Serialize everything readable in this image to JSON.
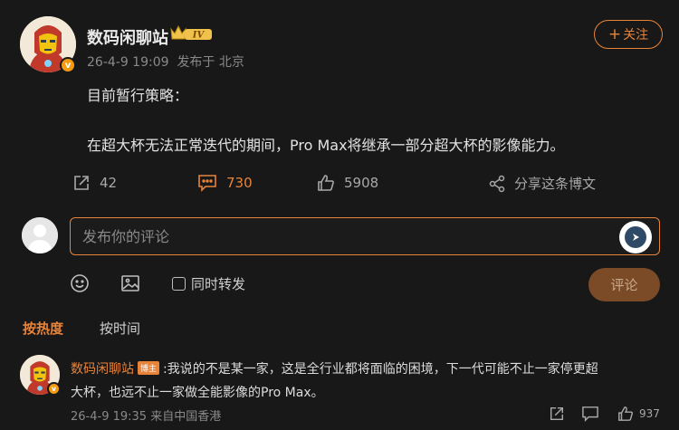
{
  "post": {
    "author": "数码闲聊站",
    "level_badge": "IV",
    "verified_mark": "v",
    "time": "26-4-9 19:09",
    "location": "发布于 北京",
    "follow_label": "关注",
    "text_line1": "目前暂行策略：",
    "text_line2": "在超大杯无法正常迭代的期间，Pro Max将继承一部分超大杯的影像能力。"
  },
  "actions": {
    "repost_count": "42",
    "comment_count": "730",
    "like_count": "5908",
    "share_label": "分享这条博文"
  },
  "composer": {
    "placeholder": "发布你的评论",
    "also_repost_label": "同时转发",
    "submit_label": "评论"
  },
  "sort_tabs": {
    "hot": "按热度",
    "time": "按时间"
  },
  "comment": {
    "author": "数码闲聊站",
    "host_badge": "博主",
    "text_line1": ":我说的不是某一家，这是全行业都将面临的困境，下一代可能不止一家停更超",
    "text_line2": "大杯，也远不止一家做全能影像的Pro Max。",
    "meta": "26-4-9 19:35 来自中国香港",
    "like_count": "937"
  },
  "colors": {
    "background": "#181818",
    "accent": "#e8843a",
    "text": "#e3e3e3",
    "muted": "#8a8a8a"
  },
  "icons": [
    "repost-icon",
    "comment-icon",
    "like-icon",
    "share-icon",
    "emoji-icon",
    "image-icon",
    "reply-icon",
    "comment-like-icon",
    "crown-icon",
    "send-icon"
  ]
}
